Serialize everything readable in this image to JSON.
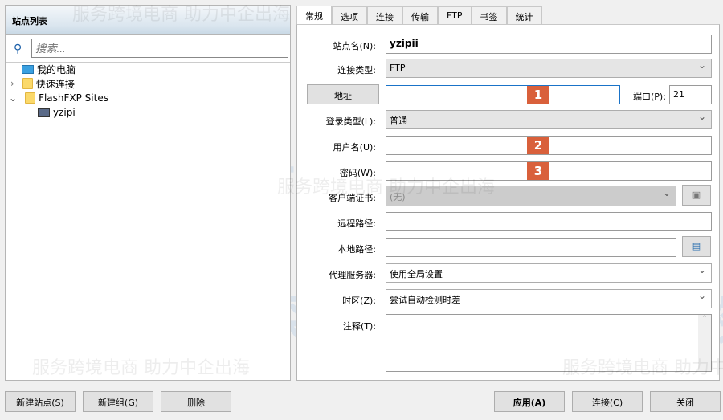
{
  "watermark": {
    "logo": "主机侦探",
    "slogan": "服务跨境电商 助力中企出海"
  },
  "site_list": {
    "title": "站点列表",
    "search_placeholder": "搜索...",
    "tree": [
      {
        "label": "我的电脑",
        "icon": "computer-icon"
      },
      {
        "label": "快速连接",
        "icon": "folder-icon",
        "expanded": false
      },
      {
        "label": "FlashFXP Sites",
        "icon": "folder-icon",
        "expanded": true
      },
      {
        "label": "yzipi",
        "icon": "server-icon"
      }
    ]
  },
  "tabs": [
    "常规",
    "选项",
    "连接",
    "传输",
    "FTP",
    "书签",
    "统计"
  ],
  "form": {
    "site_name_label": "站点名(N):",
    "site_name": "yzipii",
    "conn_type_label": "连接类型:",
    "conn_type": "FTP",
    "address_button": "地址",
    "address": "",
    "port_label": "端口(P):",
    "port": "21",
    "login_type_label": "登录类型(L):",
    "login_type": "普通",
    "username_label": "用户名(U):",
    "username": "",
    "password_label": "密码(W):",
    "password": "",
    "cert_label": "客户端证书:",
    "cert": "(无)",
    "remote_path_label": "远程路径:",
    "remote_path": "",
    "local_path_label": "本地路径:",
    "local_path": "",
    "proxy_label": "代理服务器:",
    "proxy": "使用全局设置",
    "timezone_label": "时区(Z):",
    "timezone": "尝试自动检测时差",
    "notes_label": "注释(T):",
    "notes": ""
  },
  "badges": [
    "1",
    "2",
    "3"
  ],
  "badge_color": "#d9603b",
  "buttons": {
    "new_site": "新建站点(S)",
    "new_group": "新建组(G)",
    "delete": "删除",
    "apply": "应用(A)",
    "connect": "连接(C)",
    "close": "关闭"
  }
}
